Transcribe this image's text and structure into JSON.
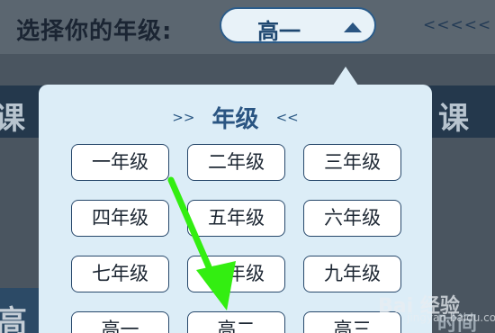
{
  "header": {
    "label": "选择你的年级:",
    "selected_grade": "高一",
    "nav_arrows": "<<<<<"
  },
  "background": {
    "band_left": "课",
    "band_right": "课",
    "bottom_left": "高",
    "bottom_right": "时间"
  },
  "popup": {
    "deco_left": ">>",
    "title": "年级",
    "deco_right": "<<",
    "grades": [
      "一年级",
      "二年级",
      "三年级",
      "四年级",
      "五年级",
      "六年级",
      "七年级",
      "八年级",
      "九年级",
      "高一",
      "高二",
      "高三"
    ]
  },
  "watermark": {
    "text": "Bai 经验",
    "sub": "jingyan.baidu.com"
  },
  "colors": {
    "accent": "#2a5582",
    "annotation_arrow": "#33ee11",
    "popup_bg": "#dcedf7"
  }
}
